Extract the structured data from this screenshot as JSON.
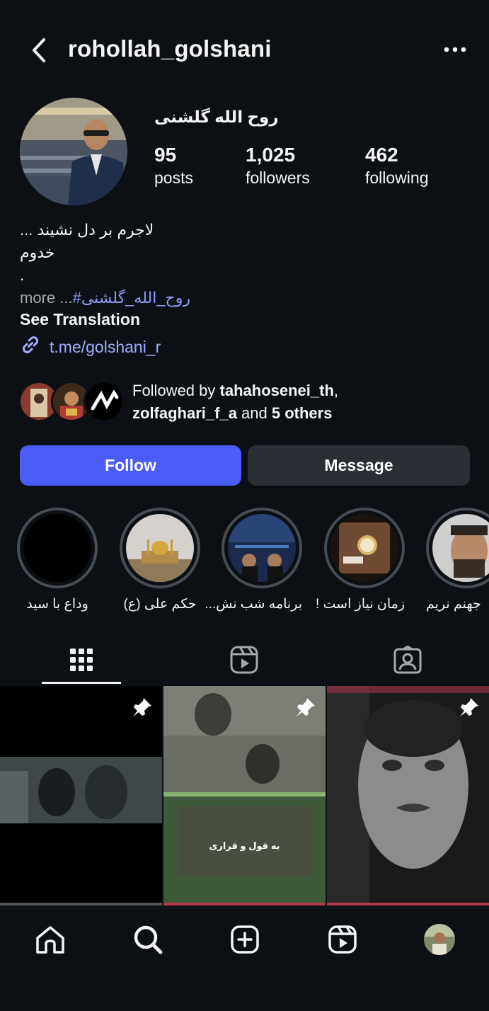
{
  "header": {
    "username": "rohollah_golshani",
    "back_icon": "chevron-left-icon",
    "more_icon": "more-horizontal-icon"
  },
  "profile": {
    "full_name": "روح الله گلشنی",
    "stats": [
      {
        "value": "95",
        "label": "posts"
      },
      {
        "value": "1,025",
        "label": "followers"
      },
      {
        "value": "462",
        "label": "following"
      }
    ]
  },
  "bio": {
    "line1": "لاجرم بر دل نشیند ...",
    "line2": "خدوم",
    "line3": ".",
    "more_label": "more",
    "ellipsis": " ...",
    "hashtag": "#روح_الله_گلشنی",
    "see_translation": "See Translation",
    "link": "t.me/golshani_r"
  },
  "followed_by": {
    "prefix": "Followed by ",
    "user1": "tahahosenei_th",
    "comma": ",",
    "user2": "zolfaghari_f_a",
    "and_text": " and ",
    "others": "5 others"
  },
  "actions": {
    "follow": "Follow",
    "message": "Message"
  },
  "highlights": [
    {
      "label": "وداع با سید"
    },
    {
      "label": "حکم علی (ع)"
    },
    {
      "label": "برنامه شب نش..."
    },
    {
      "label": "زمان نیاز است !"
    },
    {
      "label": "جهنم نریم"
    }
  ],
  "grid_posts": [
    {
      "caption": "",
      "pinned": true
    },
    {
      "caption": "یه قول و قراری",
      "pinned": true
    },
    {
      "caption": "",
      "pinned": true
    }
  ],
  "colors": {
    "background": "#0c1014",
    "follow_button": "#4a5df9",
    "message_button": "#2a2f35",
    "link": "#a0acff"
  }
}
